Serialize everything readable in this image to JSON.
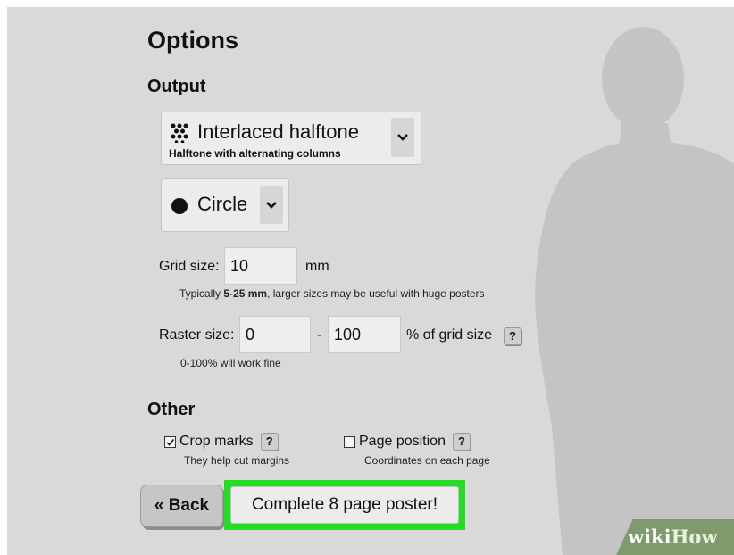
{
  "options": {
    "title": "Options",
    "output_heading": "Output",
    "halftone_select": {
      "value": "Interlaced halftone",
      "subtext": "Halftone with alternating columns",
      "icon": "dots-grid-icon"
    },
    "shape_select": {
      "value": "Circle",
      "icon": "filled-circle-icon"
    },
    "grid_size": {
      "label": "Grid size:",
      "value": "10",
      "unit": "mm",
      "hint_prefix": "Typically ",
      "hint_bold": "5-25 mm",
      "hint_suffix": ", larger sizes may be useful with huge posters"
    },
    "raster_size": {
      "label": "Raster size:",
      "min": "0",
      "separator": "-",
      "max": "100",
      "unit": "% of grid size",
      "help": "?",
      "hint": "0-100% will work fine"
    },
    "other_heading": "Other",
    "crop_marks": {
      "label": "Crop marks",
      "checked": true,
      "help": "?",
      "hint": "They help cut margins"
    },
    "page_position": {
      "label": "Page position",
      "checked": false,
      "help": "?",
      "hint": "Coordinates on each page"
    },
    "back_label": "« Back",
    "complete_label": "Complete 8 page poster!",
    "highlight_color": "#22dd22"
  },
  "watermark": {
    "wiki": "wiki",
    "how": "How"
  }
}
